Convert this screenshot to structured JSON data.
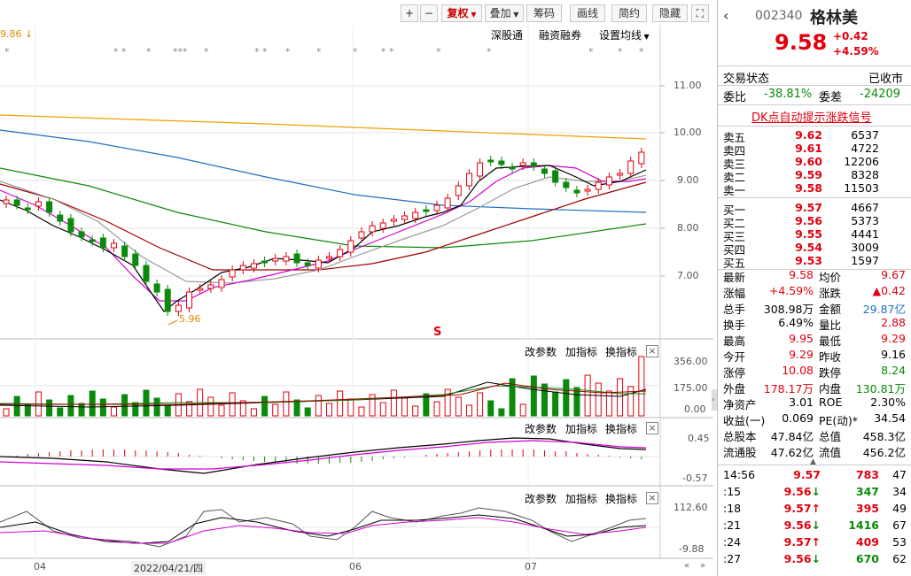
{
  "toolbar": {
    "plus": "+",
    "minus": "−",
    "fuquan": "复权",
    "diejia": "叠加",
    "chouma": "筹码",
    "huaxian": "画线",
    "jianyue": "简约",
    "yincang": "隐藏",
    "expand": "⛶"
  },
  "subbar": {
    "shengutong": "深股通",
    "rongzi": "融资融券",
    "shezhi": "设置均线"
  },
  "top_marker": "9.86",
  "low_marker": "5.96",
  "s_marker": "S",
  "main_axis": [
    "11.00",
    "10.00",
    "9.00",
    "8.00",
    "7.00"
  ],
  "vol_axis": [
    "356.00",
    "175.00",
    "0.00"
  ],
  "macd_axis": [
    "0.45",
    "-0.57"
  ],
  "kdj_axis": [
    "112.60",
    "-9.88"
  ],
  "panel_tools": {
    "gaicanshu": "改参数",
    "jiazhibiao": "加指标",
    "huanzhibiao": "换指标",
    "close": "×"
  },
  "x_axis": {
    "m04": "04",
    "date": "2022/04/21/四",
    "m06": "06",
    "m07": "07"
  },
  "stock": {
    "code": "002340",
    "name": "格林美",
    "price": "9.58",
    "change": "+0.42",
    "pct": "+4.59%"
  },
  "status": {
    "label": "交易状态",
    "value": "已收市"
  },
  "weibi": {
    "l1": "委比",
    "v1": "-38.81%",
    "l2": "委差",
    "v2": "-24209"
  },
  "dk_link": "DK点自动提示涨跌信号",
  "sells": [
    {
      "label": "卖五",
      "price": "9.62",
      "vol": "6537"
    },
    {
      "label": "卖四",
      "price": "9.61",
      "vol": "4722"
    },
    {
      "label": "卖三",
      "price": "9.60",
      "vol": "12206"
    },
    {
      "label": "卖二",
      "price": "9.59",
      "vol": "8328"
    },
    {
      "label": "卖一",
      "price": "9.58",
      "vol": "11503"
    }
  ],
  "buys": [
    {
      "label": "买一",
      "price": "9.57",
      "vol": "4667"
    },
    {
      "label": "买二",
      "price": "9.56",
      "vol": "5373"
    },
    {
      "label": "买三",
      "price": "9.55",
      "vol": "4441"
    },
    {
      "label": "买四",
      "price": "9.54",
      "vol": "3009"
    },
    {
      "label": "买五",
      "price": "9.53",
      "vol": "1597"
    }
  ],
  "stats": [
    {
      "l1": "最新",
      "v1": "9.58",
      "c1": "red",
      "l2": "均价",
      "v2": "9.67",
      "c2": "red"
    },
    {
      "l1": "涨幅",
      "v1": "+4.59%",
      "c1": "red",
      "l2": "涨跌",
      "v2": "▲0.42",
      "c2": "red"
    },
    {
      "l1": "总手",
      "v1": "308.98万",
      "c1": "",
      "l2": "金额",
      "v2": "29.87亿",
      "c2": "blue"
    },
    {
      "l1": "换手",
      "v1": "6.49%",
      "c1": "",
      "l2": "量比",
      "v2": "2.88",
      "c2": "red"
    },
    {
      "l1": "最高",
      "v1": "9.95",
      "c1": "red",
      "l2": "最低",
      "v2": "9.29",
      "c2": "red"
    },
    {
      "l1": "今开",
      "v1": "9.29",
      "c1": "red",
      "l2": "昨收",
      "v2": "9.16",
      "c2": ""
    },
    {
      "l1": "涨停",
      "v1": "10.08",
      "c1": "red",
      "l2": "跌停",
      "v2": "8.24",
      "c2": "green"
    },
    {
      "l1": "外盘",
      "v1": "178.17万",
      "c1": "red",
      "l2": "内盘",
      "v2": "130.81万",
      "c2": "green"
    },
    {
      "l1": "净资产",
      "v1": "3.01",
      "c1": "",
      "l2": "ROE",
      "v2": "2.30%",
      "c2": ""
    },
    {
      "l1": "收益(一)",
      "v1": "0.069",
      "c1": "",
      "l2": "PE(动)*",
      "v2": "34.54",
      "c2": ""
    },
    {
      "l1": "总股本",
      "v1": "47.84亿",
      "c1": "",
      "l2": "总值",
      "v2": "458.3亿",
      "c2": ""
    },
    {
      "l1": "流通股",
      "v1": "47.62亿",
      "c1": "",
      "l2": "流值",
      "v2": "456.2亿",
      "c2": ""
    }
  ],
  "ticks": [
    {
      "time": "14:56",
      "price": "9.57",
      "dir": "",
      "vol": "783",
      "cnt": "47",
      "pc": "red",
      "vc": "red"
    },
    {
      "time": ":15",
      "price": "9.56",
      "dir": "↓",
      "vol": "347",
      "cnt": "34",
      "pc": "red",
      "vc": "green"
    },
    {
      "time": ":18",
      "price": "9.57",
      "dir": "↑",
      "vol": "395",
      "cnt": "49",
      "pc": "red",
      "vc": "red"
    },
    {
      "time": ":21",
      "price": "9.56",
      "dir": "↓",
      "vol": "1416",
      "cnt": "67",
      "pc": "red",
      "vc": "green"
    },
    {
      "time": ":24",
      "price": "9.57",
      "dir": "↑",
      "vol": "409",
      "cnt": "53",
      "pc": "red",
      "vc": "red"
    },
    {
      "time": ":27",
      "price": "9.56",
      "dir": "↓",
      "vol": "670",
      "cnt": "62",
      "pc": "red",
      "vc": "green"
    }
  ],
  "colors": {
    "up": "#e0000f",
    "down": "#0a8a0a",
    "ma5": "#000000",
    "ma10": "#d400d4",
    "ma20": "#9a9a9a",
    "ma30": "#a00000",
    "ma60": "#1f6fc0",
    "ma120": "#0a8a0a",
    "ma250": "#f0a000"
  }
}
